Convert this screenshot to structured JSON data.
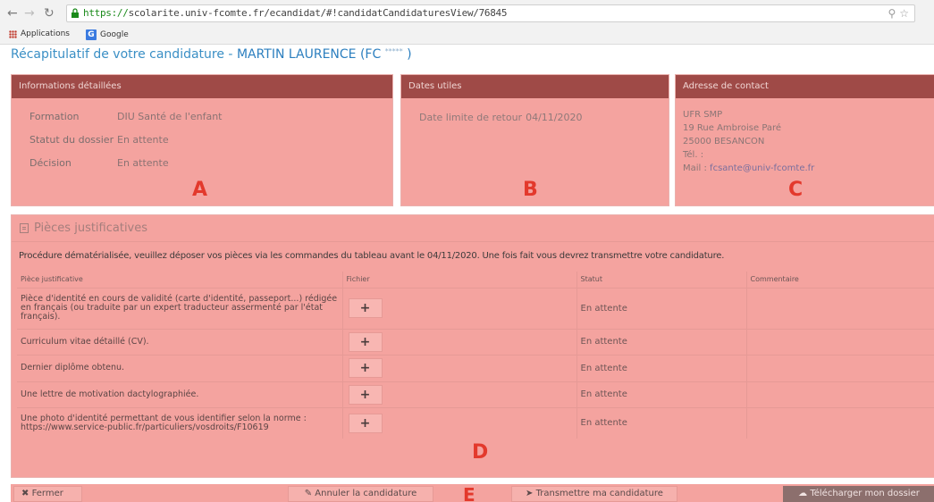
{
  "browser": {
    "url_scheme": "https://",
    "url_rest": "scolarite.univ-fcomte.fr/ecandidat/#!candidatCandidaturesView/76845",
    "bookmarks": [
      "Applications",
      "Google"
    ],
    "google_icon_letter": "G"
  },
  "page": {
    "title_prefix": "Récapitulatif de votre candidature - ",
    "candidate_name": "MARTIN LAURENCE (FC",
    "masked_id": "*****",
    "title_suffix": " )"
  },
  "info_panel": {
    "heading": "Informations détaillées",
    "rows": [
      {
        "label": "Formation",
        "value": "DIU Santé de l'enfant"
      },
      {
        "label": "Statut du dossier",
        "value": "En attente"
      },
      {
        "label": "Décision",
        "value": "En attente"
      }
    ],
    "marker": "A"
  },
  "dates_panel": {
    "heading": "Dates utiles",
    "label": "Date limite de retour",
    "value": "04/11/2020",
    "marker": "B"
  },
  "contact_panel": {
    "heading": "Adresse de contact",
    "lines": [
      "UFR SMP",
      "19 Rue Ambroise Paré",
      "25000 BESANCON",
      "Tél. :"
    ],
    "mail_label": "Mail : ",
    "mail": "fcsante@univ-fcomte.fr",
    "marker": "C"
  },
  "pieces": {
    "heading": "Pièces justificatives",
    "procedure": "Procédure dématérialisée, veuillez déposer vos pièces via les commandes du tableau avant le 04/11/2020. Une fois fait vous devrez transmettre votre candidature.",
    "columns": [
      "Pièce justificative",
      "Fichier",
      "Statut",
      "Commentaire"
    ],
    "add_label": "+",
    "rows": [
      {
        "piece": "Pièce d'identité en cours de validité (carte d'identité, passeport...) rédigée en français (ou traduite par un expert traducteur assermenté par l'état français).",
        "statut": "En attente",
        "commentaire": ""
      },
      {
        "piece": "Curriculum vitae détaillé (CV).",
        "statut": "En attente",
        "commentaire": ""
      },
      {
        "piece": "Dernier diplôme obtenu.",
        "statut": "En attente",
        "commentaire": ""
      },
      {
        "piece": "Une lettre de motivation dactylographiée.",
        "statut": "En attente",
        "commentaire": ""
      },
      {
        "piece": "Une photo d'identité permettant de vous identifier selon la norme : https://www.service-public.fr/particuliers/vosdroits/F10619",
        "statut": "En attente",
        "commentaire": ""
      }
    ],
    "marker": "D"
  },
  "footer": {
    "close_label": "Fermer",
    "cancel_label": "Annuler la candidature",
    "send_label": "Transmettre ma candidature",
    "download_label": "Télécharger mon dossier",
    "marker": "E"
  },
  "colors": {
    "overlay": "#f4a39f",
    "panel_header": "#9f4a47",
    "marker_red": "#e3392c",
    "title_blue": "#3a8fc5"
  }
}
